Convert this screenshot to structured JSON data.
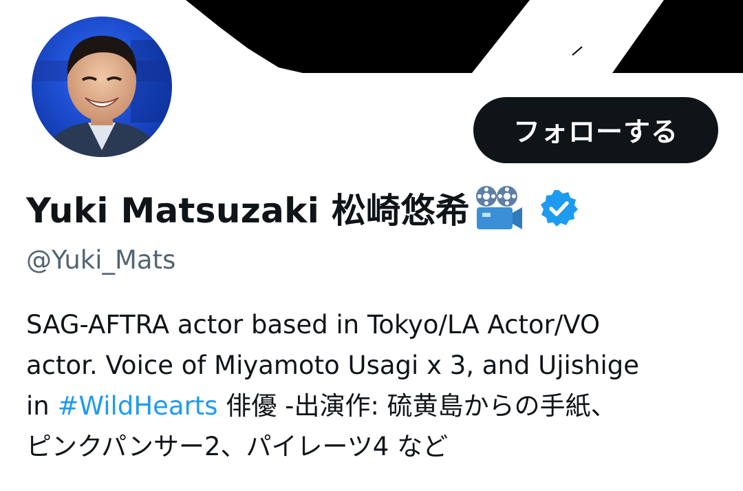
{
  "profile": {
    "display_name": "Yuki Matsuzaki 松崎悠希",
    "handle": "@Yuki_Mats",
    "follow_label": "フォローする",
    "name_emoji": "movie-camera-icon",
    "verified": true,
    "bio": {
      "line1": "SAG-AFTRA actor based in Tokyo/LA Actor/VO",
      "line2": "actor. Voice of Miyamoto Usagi x 3, and Ujishige",
      "line3_prefix": "in ",
      "hashtag": "#WildHearts",
      "line3_suffix": " 俳優 -出演作: 硫黄島からの手紙、",
      "line4": "ピンクパンサー2、パイレーツ4 など"
    }
  },
  "colors": {
    "text": "#0f1419",
    "secondary": "#536471",
    "accent": "#1d9bf0",
    "follow_button_bg": "#0f1419",
    "follow_button_text": "#ffffff",
    "avatar_background": "#1a4fd8"
  },
  "icons": {
    "verified": "verified-badge-icon",
    "camera": "movie-camera-icon"
  }
}
